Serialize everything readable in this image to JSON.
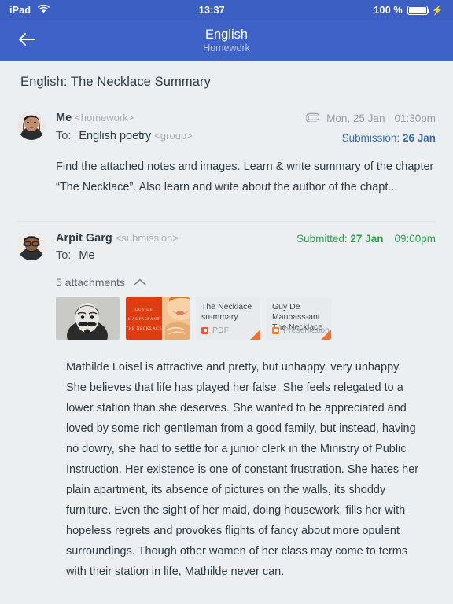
{
  "status_bar": {
    "device": "iPad",
    "wifi_icon": "wifi-icon",
    "time": "13:37",
    "battery_percent": "100 %",
    "battery_icon": "battery-full-icon",
    "charging_icon": "lightning-bolt-icon",
    "background_color": "#3c5fc4"
  },
  "app_bar": {
    "back_icon": "back-arrow-icon",
    "title": "English",
    "subtitle": "Homework",
    "background_color": "#3f62c8"
  },
  "page": {
    "subject_title": "English: The Necklace Summary",
    "background_color": "#eceff1"
  },
  "messages": [
    {
      "avatar": "avatar-female-photo",
      "sender_name": "Me",
      "sender_tag": "<homework>",
      "to_label": "To:",
      "to_value": "English poetry",
      "to_tag": "<group>",
      "attachment_icon": "paperclip-icon",
      "date": "Mon, 25 Jan",
      "time": "01:30pm",
      "submission_label": "Submission:",
      "submission_date": "26 Jan",
      "submission_color": "#3a6ea8",
      "body": "Find the attached notes and images. Learn & write summary of the chapter  “The Necklace”. Also learn and write about the author of the chapt..."
    },
    {
      "avatar": "avatar-male-photo",
      "sender_name": "Arpit Garg",
      "sender_tag": "<submission>",
      "to_label": "To:",
      "to_value": "Me",
      "to_tag": "",
      "submitted_label": "Submitted:",
      "submitted_date": "27 Jan",
      "submitted_time": "09:00pm",
      "submitted_color": "#2ca24a",
      "attachments_label": "5 attachments",
      "attachments_toggle_icon": "chevron-up-icon",
      "attachments": [
        {
          "kind": "image",
          "name": "guy-de-maupassant-portrait-photo",
          "title": "",
          "type": ""
        },
        {
          "kind": "image",
          "name": "the-necklace-book-cover",
          "title": "",
          "type": "",
          "cover_lines": [
            "GUY DE",
            "MAUPASSANT",
            "THE NECKLACE"
          ]
        },
        {
          "kind": "doc",
          "name": "pdf-attachment",
          "title": "The Necklace su-mmary",
          "type": "PDF",
          "type_color": "#e8573f"
        },
        {
          "kind": "doc",
          "name": "presentation-attachment",
          "title": "Guy De Maupass-ant The Necklace",
          "type": "Presentation",
          "type_color": "#e8833a"
        }
      ],
      "body": "Mathilde Loisel is attractive and pretty, but unhappy, very unhappy. She believes that life has played her false. She feels relegated to a lower station than she deserves. She wanted to be appreciated and loved by some rich gentleman from a good family, but instead, having no dowry, she had to settle for a junior clerk in the Ministry of Public Instruction. Her existence is one of constant frustration. She hates her plain apartment, its absence of pictures on the walls, its shoddy furniture. Even the sight of her maid, doing housework, fills her with hopeless regrets and provokes flights of fancy about more opulent surroundings. Though other women of her class may come to terms with their station in life, Mathilde never can."
    }
  ]
}
